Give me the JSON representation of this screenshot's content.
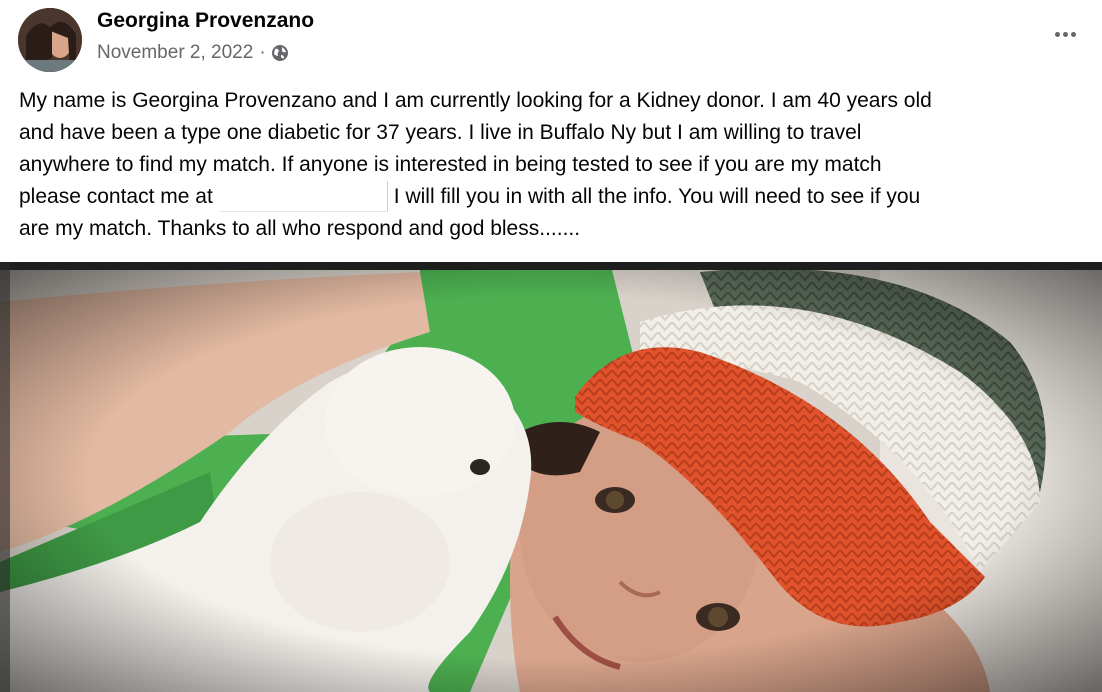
{
  "post": {
    "author_name": "Georgina Provenzano",
    "date": "November 2, 2022",
    "separator": "·",
    "audience_icon": "globe-icon",
    "more_icon": "more-options-icon",
    "text_lines": [
      "My name is Georgina Provenzano and I am currently looking for a Kidney donor. I am 40 years old",
      "and have been a type one diabetic for 37 years. I live in Buffalo Ny but I am willing to travel",
      "anywhere to find my match. If anyone is interested in being tested to see if you are my match",
      "I will fill you in with all the info. You will need to see if you",
      "are my match. Thanks to all who respond and god bless......."
    ],
    "contact_prefix": "please contact me at"
  },
  "colors": {
    "text": "#050505",
    "secondary_text": "#65676b",
    "hat_orange": "#e0532c",
    "hat_green": "#5b6a5a",
    "shirt_green": "#4caf50"
  }
}
